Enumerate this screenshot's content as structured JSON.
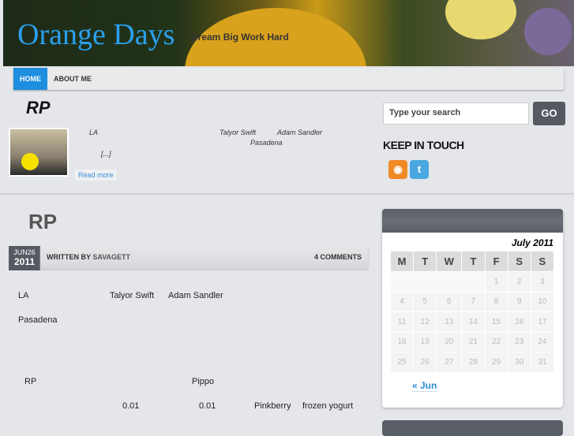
{
  "site": {
    "title": "Orange Days",
    "tagline": "Dream Big Work Hard"
  },
  "nav": [
    {
      "label": "HOME"
    },
    {
      "label": "ABOUT ME"
    }
  ],
  "featured": {
    "title": "RP",
    "excerpt": [
      "LA",
      "Talyor Swift",
      "Adam Sandler",
      "Pasadena",
      "[...]"
    ],
    "read_more": "Read more"
  },
  "sidebar": {
    "search_placeholder": "Type your search",
    "go": "GO",
    "keep_in_touch": "KEEP IN TOUCH",
    "icons": [
      "rss-icon",
      "twitter-icon"
    ]
  },
  "post": {
    "title": "RP",
    "month_day": "JUN26",
    "year": "2011",
    "written_by": "WRITTEN BY",
    "author": "SAVAGETT",
    "comments": "4 COMMENTS",
    "body": [
      "LA",
      "Talyor Swift",
      "Adam Sandler",
      "Pasadena",
      "RP",
      "Pippo",
      "0.01",
      "0.01",
      "Pinkberry",
      "frozen yogurt"
    ]
  },
  "calendar": {
    "caption": "July 2011",
    "headers": [
      "M",
      "T",
      "W",
      "T",
      "F",
      "S",
      "S"
    ],
    "weeks": [
      [
        "",
        "",
        "",
        "",
        "1",
        "2",
        "3"
      ],
      [
        "4",
        "5",
        "6",
        "7",
        "8",
        "9",
        "10"
      ],
      [
        "11",
        "12",
        "13",
        "14",
        "15",
        "16",
        "17"
      ],
      [
        "18",
        "19",
        "20",
        "21",
        "22",
        "23",
        "24"
      ],
      [
        "25",
        "26",
        "27",
        "28",
        "29",
        "30",
        "31"
      ]
    ],
    "prev": "« Jun"
  }
}
